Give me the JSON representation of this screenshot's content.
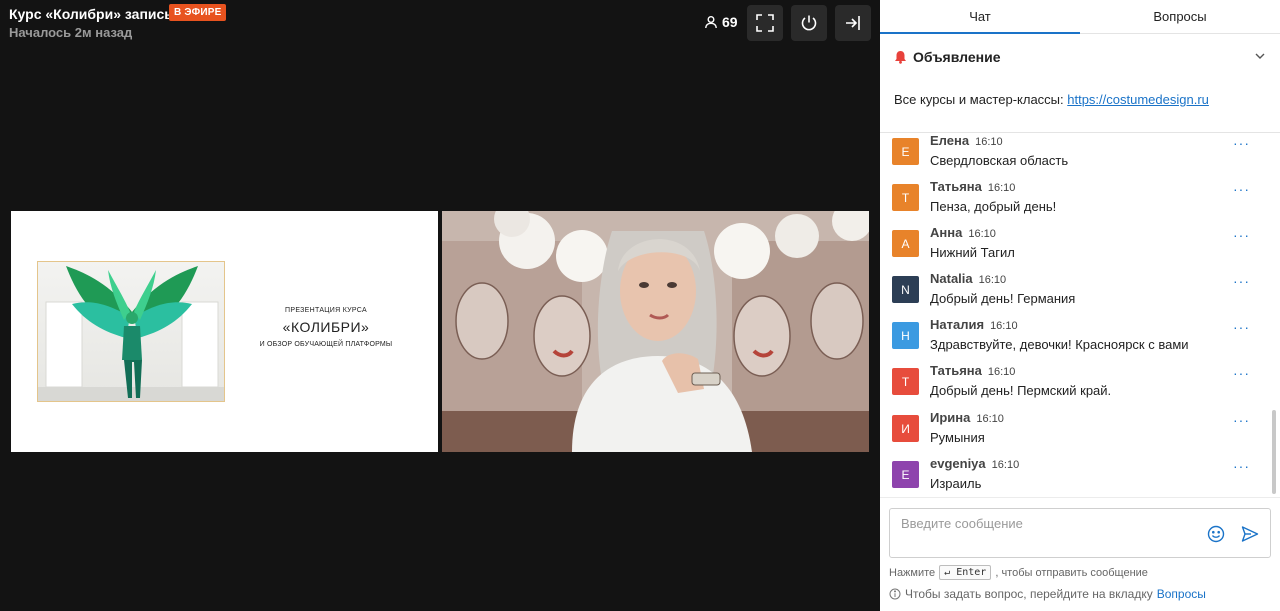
{
  "header": {
    "title": "Курс «Колибри» запись",
    "live_badge": "В ЭФИРЕ",
    "started": "Началось 2м назад",
    "viewers": "69"
  },
  "slide": {
    "subtitle_top": "ПРЕЗЕНТАЦИЯ КУРСА",
    "main_title": "«КОЛИБРИ»",
    "subtitle_bottom": "И ОБЗОР ОБУЧАЮЩЕЙ ПЛАТФОРМЫ"
  },
  "tabs": [
    {
      "label": "Чат"
    },
    {
      "label": "Вопросы"
    }
  ],
  "announcement": {
    "title": "Объявление",
    "text": "Все курсы и мастер-классы: ",
    "link": "https://costumedesign.ru"
  },
  "messages": [
    {
      "initial": "Е",
      "name": "Елена",
      "time": "16:10",
      "text": "Свердловская область",
      "color": "#e8832a"
    },
    {
      "initial": "Т",
      "name": "Татьяна",
      "time": "16:10",
      "text": "Пенза, добрый день!",
      "color": "#e8832a"
    },
    {
      "initial": "А",
      "name": "Анна",
      "time": "16:10",
      "text": "Нижний Тагил",
      "color": "#e8832a"
    },
    {
      "initial": "N",
      "name": "Natalia",
      "time": "16:10",
      "text": "Добрый день! Германия",
      "color": "#2c3e55"
    },
    {
      "initial": "Н",
      "name": "Наталия",
      "time": "16:10",
      "text": "Здравствуйте, девочки! Красноярск с вами",
      "color": "#3b9ae1"
    },
    {
      "initial": "Т",
      "name": "Татьяна",
      "time": "16:10",
      "text": "Добрый день! Пермский край.",
      "color": "#e74c3c"
    },
    {
      "initial": "И",
      "name": "Ирина",
      "time": "16:10",
      "text": "Румыния",
      "color": "#e74c3c"
    },
    {
      "initial": "E",
      "name": "evgeniya",
      "time": "16:10",
      "text": "Израиль",
      "color": "#8e44ad"
    }
  ],
  "input": {
    "placeholder": "Введите сообщение"
  },
  "hint": {
    "before": "Нажмите",
    "key": "↵ Enter",
    "after": ", чтобы отправить сообщение",
    "question_text": "Чтобы задать вопрос, перейдите на вкладку",
    "question_link": "Вопросы"
  },
  "colors": {
    "accent": "#1a73c8",
    "live": "#e8531f"
  }
}
